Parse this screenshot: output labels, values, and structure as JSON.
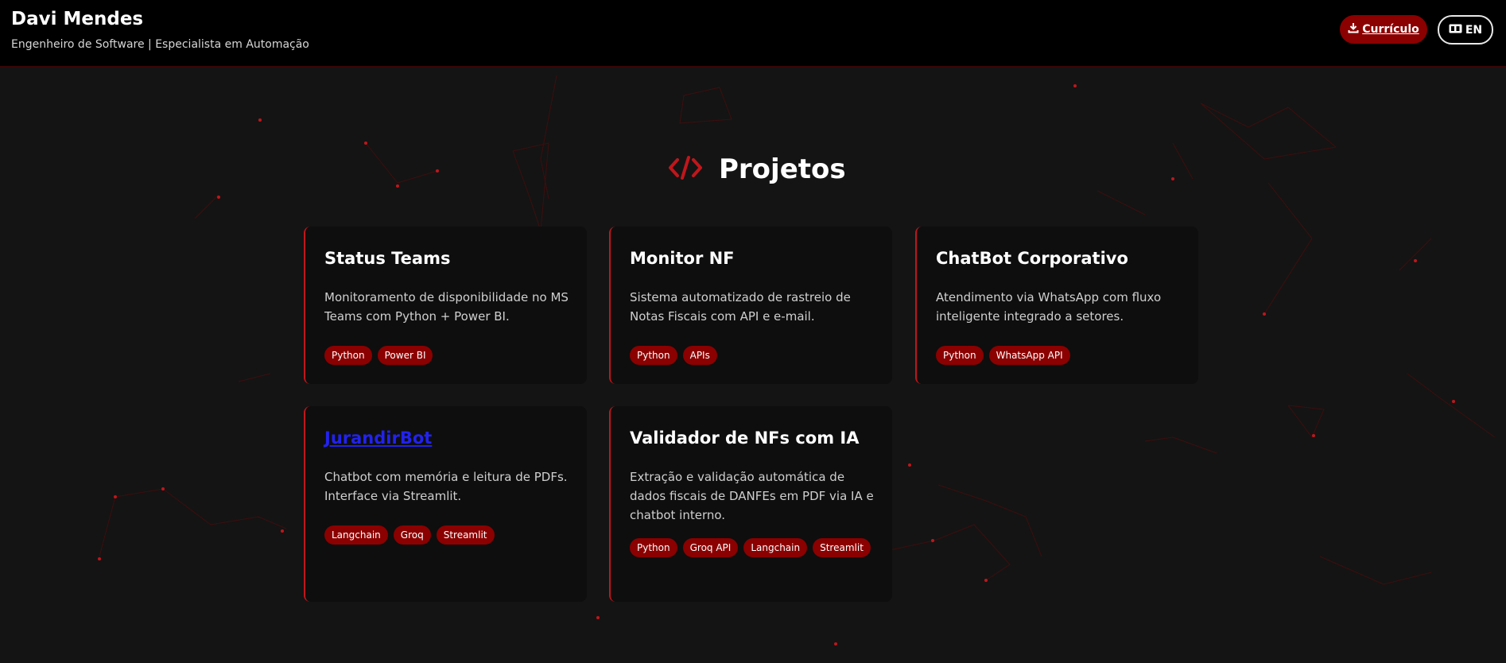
{
  "header": {
    "name": "Davi Mendes",
    "subtitle": "Engenheiro de Software | Especialista em Automação",
    "cv_label": "Currículo",
    "lang_label": "EN"
  },
  "section": {
    "title": "Projetos",
    "icon": "code-icon"
  },
  "projects": [
    {
      "title": "Status Teams",
      "description": "Monitoramento de disponibilidade no MS Teams com Python + Power BI.",
      "tags": [
        "Python",
        "Power BI"
      ]
    },
    {
      "title": "Monitor NF",
      "description": "Sistema automatizado de rastreio de Notas Fiscais com API e e-mail.",
      "tags": [
        "Python",
        "APIs"
      ]
    },
    {
      "title": "ChatBot Corporativo",
      "description": "Atendimento via WhatsApp com fluxo inteligente integrado a setores.",
      "tags": [
        "Python",
        "WhatsApp API"
      ]
    },
    {
      "title": "JurandirBot",
      "description": "Chatbot com memória e leitura de PDFs. Interface via Streamlit.",
      "tags": [
        "Langchain",
        "Groq",
        "Streamlit"
      ]
    },
    {
      "title": "Validador de NFs com IA",
      "description": "Extração e validação automática de dados fiscais de DANFEs em PDF via IA e chatbot interno.",
      "tags": [
        "Python",
        "Groq API",
        "Langchain",
        "Streamlit"
      ]
    }
  ],
  "colors": {
    "accent": "#c0161b",
    "tag_bg": "#8b0000",
    "background": "#141414",
    "card_bg": "#0e0e0e"
  }
}
